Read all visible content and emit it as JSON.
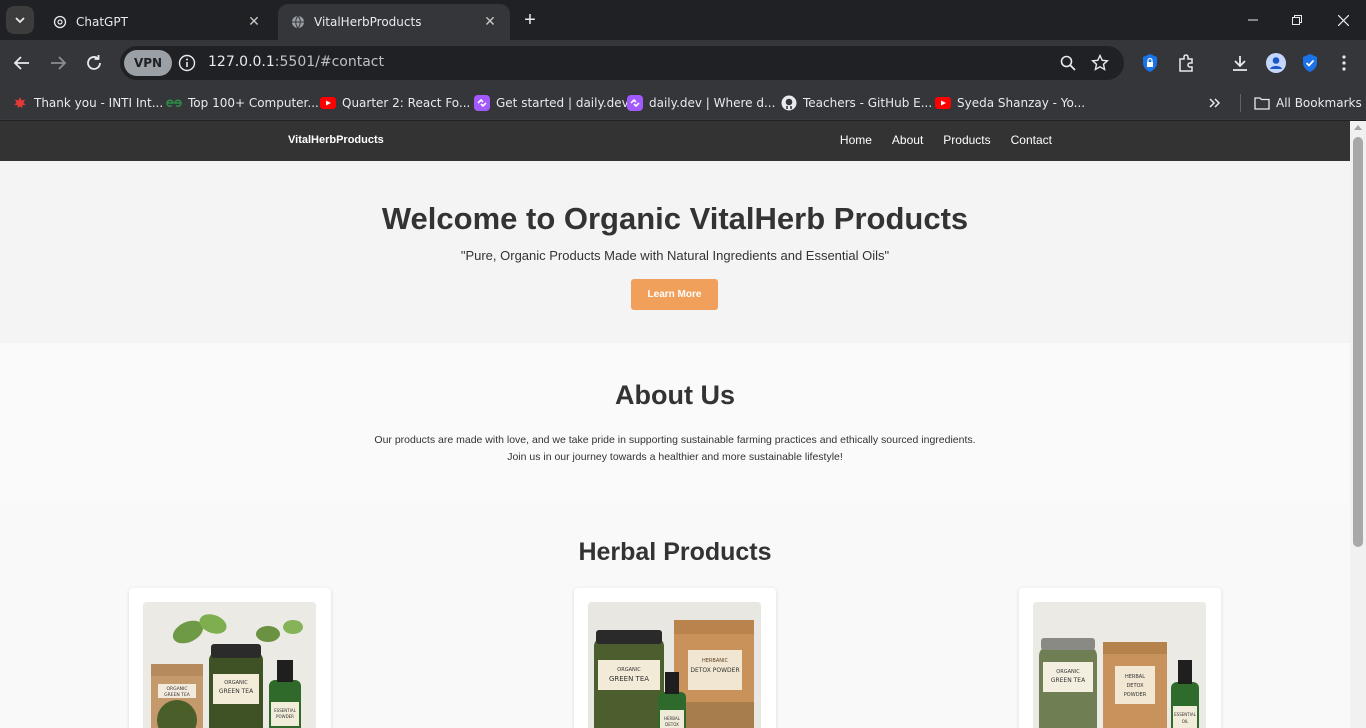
{
  "browser": {
    "tabs": [
      {
        "title": "ChatGPT",
        "active": false
      },
      {
        "title": "VitalHerbProducts",
        "active": true
      }
    ],
    "vpn_label": "VPN",
    "url_host": "127.0.0.1",
    "url_rest": ":5501/#contact",
    "bookmarks": [
      {
        "label": "Thank you - INTI Int...",
        "icon": "maple-leaf-icon"
      },
      {
        "label": "Top 100+ Computer...",
        "icon": "gfg-icon"
      },
      {
        "label": "Quarter 2: React Fo...",
        "icon": "youtube-icon"
      },
      {
        "label": "Get started | daily.dev",
        "icon": "dailydev-icon"
      },
      {
        "label": "daily.dev | Where d...",
        "icon": "dailydev-icon"
      },
      {
        "label": "Teachers - GitHub E...",
        "icon": "github-icon"
      },
      {
        "label": "Syeda Shanzay - Yo...",
        "icon": "youtube-icon"
      }
    ],
    "all_bookmarks_label": "All Bookmarks"
  },
  "site": {
    "brand": "VitalHerbProducts",
    "nav": [
      "Home",
      "About",
      "Products",
      "Contact"
    ],
    "hero": {
      "title": "Welcome to Organic VitalHerb Products",
      "subtitle": "\"Pure, Organic Products Made with Natural Ingredients and Essential Oils\"",
      "button": "Learn More"
    },
    "about": {
      "title": "About Us",
      "line1": "Our products are made with love, and we take pride in supporting sustainable farming practices and ethically sourced ingredients.",
      "line2": "Join us in our journey towards a healthier and more sustainable lifestyle!"
    },
    "products": {
      "title": "Herbal Products",
      "items": [
        {
          "image": "organic-green-tea-and-essential-oil-photo"
        },
        {
          "image": "green-tea-and-herbal-detox-powder-photo"
        },
        {
          "image": "green-tea-detox-powder-and-oil-photo"
        }
      ]
    },
    "colors": {
      "nav_bg": "#333333",
      "accent_button": "#f0a05a",
      "hero_bg": "#f4f4f4"
    }
  }
}
